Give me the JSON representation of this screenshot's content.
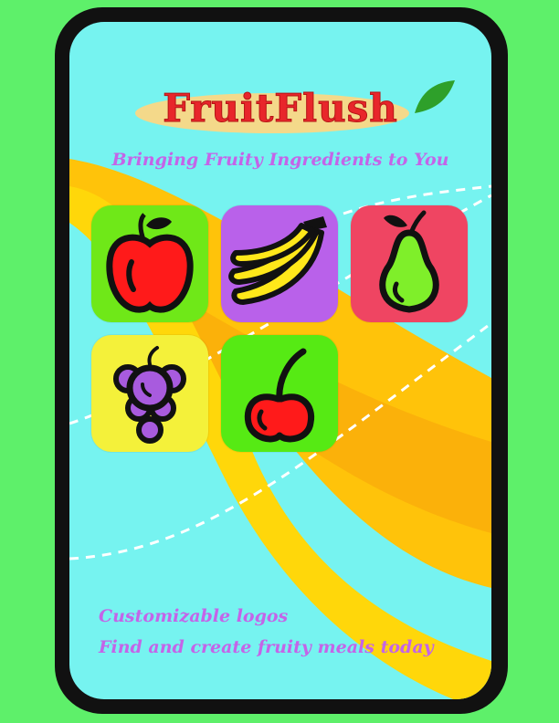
{
  "brand": {
    "name": "FruitFlush",
    "tagline": "Bringing Fruity Ingredients to You"
  },
  "fruits": [
    {
      "name": "apple",
      "tile_color": "#6fe818"
    },
    {
      "name": "banana",
      "tile_color": "#b961ea"
    },
    {
      "name": "pear",
      "tile_color": "#ef4562"
    },
    {
      "name": "grapes",
      "tile_color": "#f4f13a"
    },
    {
      "name": "cherry",
      "tile_color": "#56ea14"
    }
  ],
  "footer": {
    "line1": "Customizable logos",
    "line2": "Find and create fruity meals today"
  },
  "colors": {
    "background": "#5ef06a",
    "screen": "#76f3f0",
    "title": "#e8262b",
    "accent_text": "#c464e8"
  }
}
